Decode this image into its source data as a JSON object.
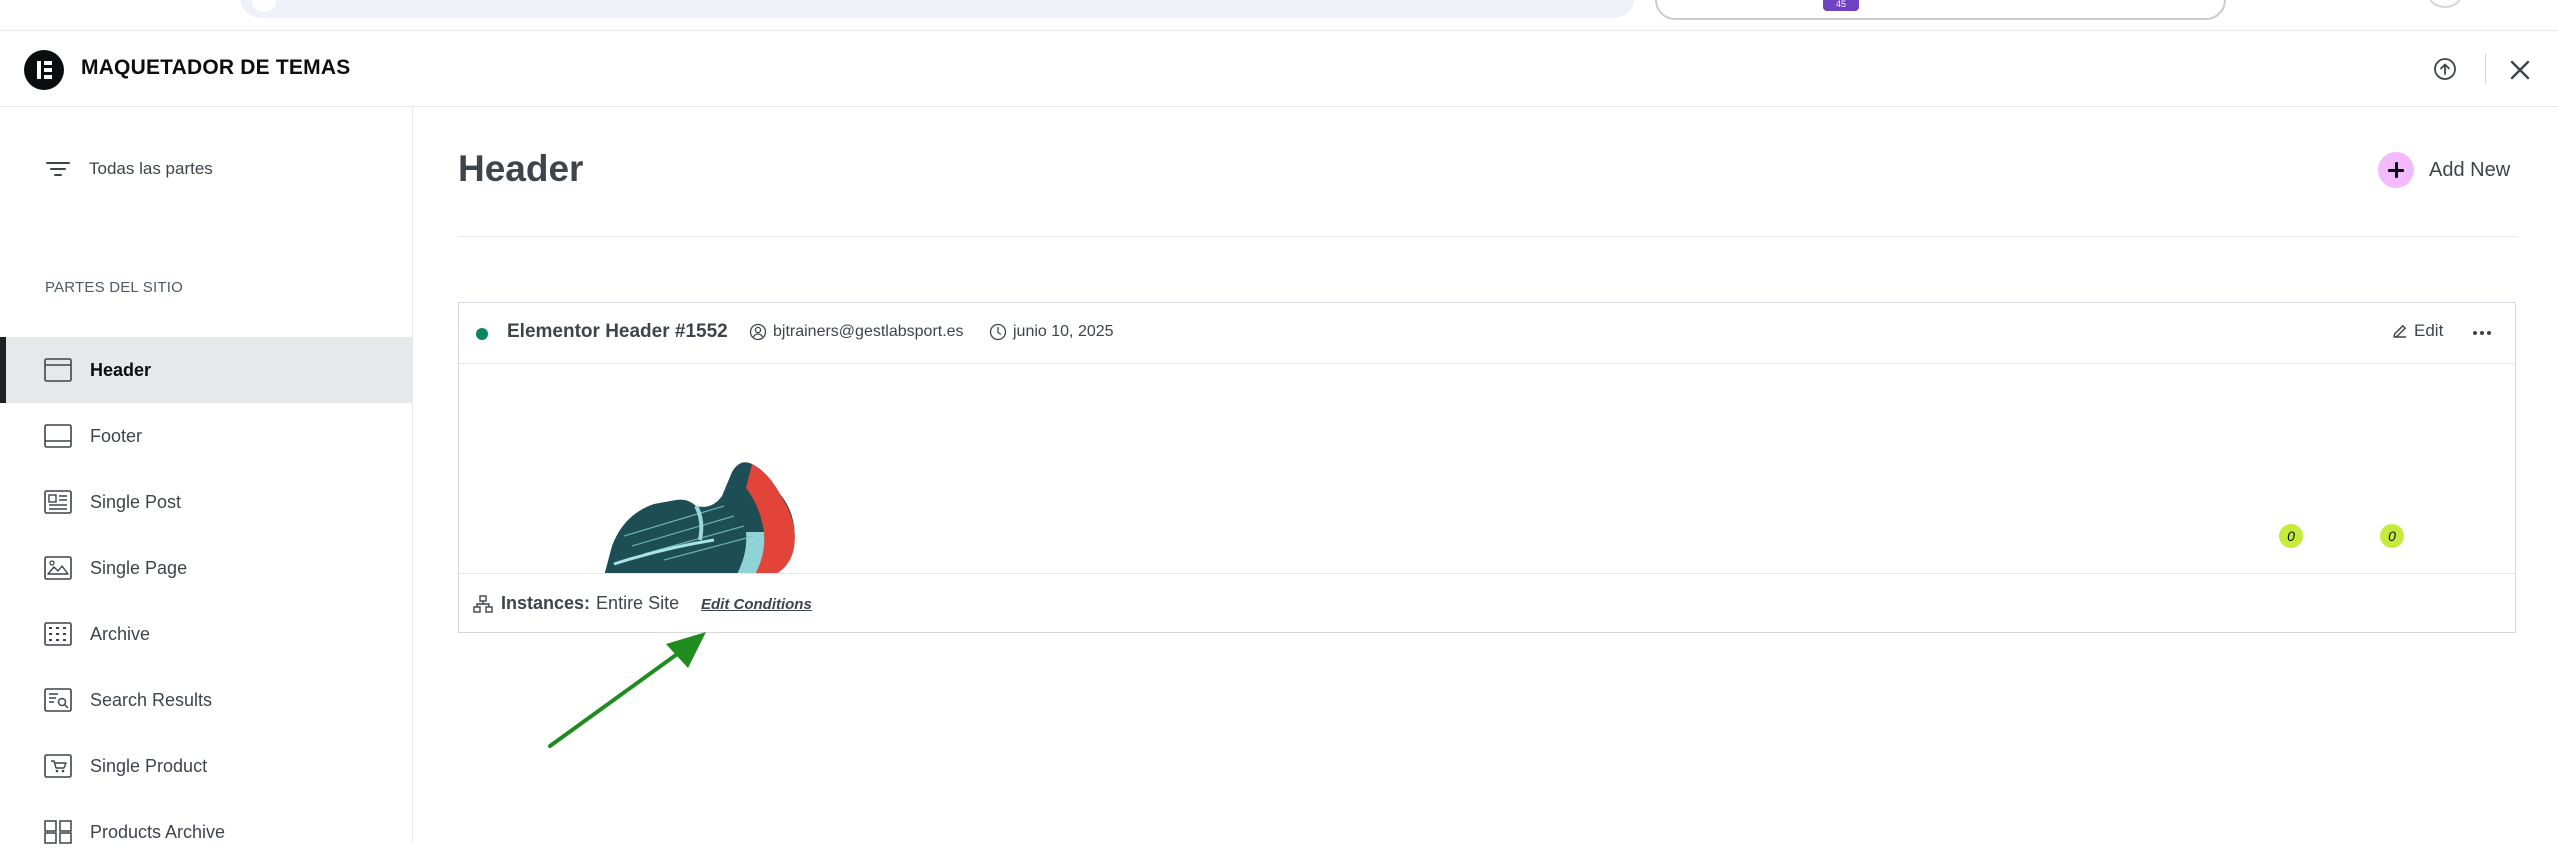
{
  "browser": {
    "tab_count": "45"
  },
  "header": {
    "title": "MAQUETADOR DE TEMAS",
    "logo_icon": "elementor-logo-icon",
    "upload_icon": "upload-circle-icon",
    "close_icon": "close-icon"
  },
  "sidebar": {
    "all_parts_label": "Todas las partes",
    "section_label": "PARTES DEL SITIO",
    "items": [
      {
        "label": "Header",
        "icon": "header-layout-icon",
        "active": true
      },
      {
        "label": "Footer",
        "icon": "footer-layout-icon",
        "active": false
      },
      {
        "label": "Single Post",
        "icon": "single-post-icon",
        "active": false
      },
      {
        "label": "Single Page",
        "icon": "single-page-icon",
        "active": false
      },
      {
        "label": "Archive",
        "icon": "archive-grid-icon",
        "active": false
      },
      {
        "label": "Search Results",
        "icon": "search-results-icon",
        "active": false
      },
      {
        "label": "Single Product",
        "icon": "single-product-icon",
        "active": false
      },
      {
        "label": "Products Archive",
        "icon": "products-archive-icon",
        "active": false
      }
    ]
  },
  "main": {
    "page_title": "Header",
    "add_new_label": "Add New",
    "card": {
      "title": "Elementor Header #1552",
      "author": "bjtrainers@gestlabsport.es",
      "date": "junio 10, 2025",
      "edit_label": "Edit",
      "badges": [
        "0",
        "0"
      ],
      "instances_label": "Instances:",
      "instances_value": "Entire Site",
      "edit_conditions_label": "Edit Conditions"
    }
  },
  "colors": {
    "active_status": "#0a875a",
    "add_new_accent": "#f3bafd",
    "badge": "#c5ec3c",
    "annotation_arrow": "#1e8c1e"
  }
}
